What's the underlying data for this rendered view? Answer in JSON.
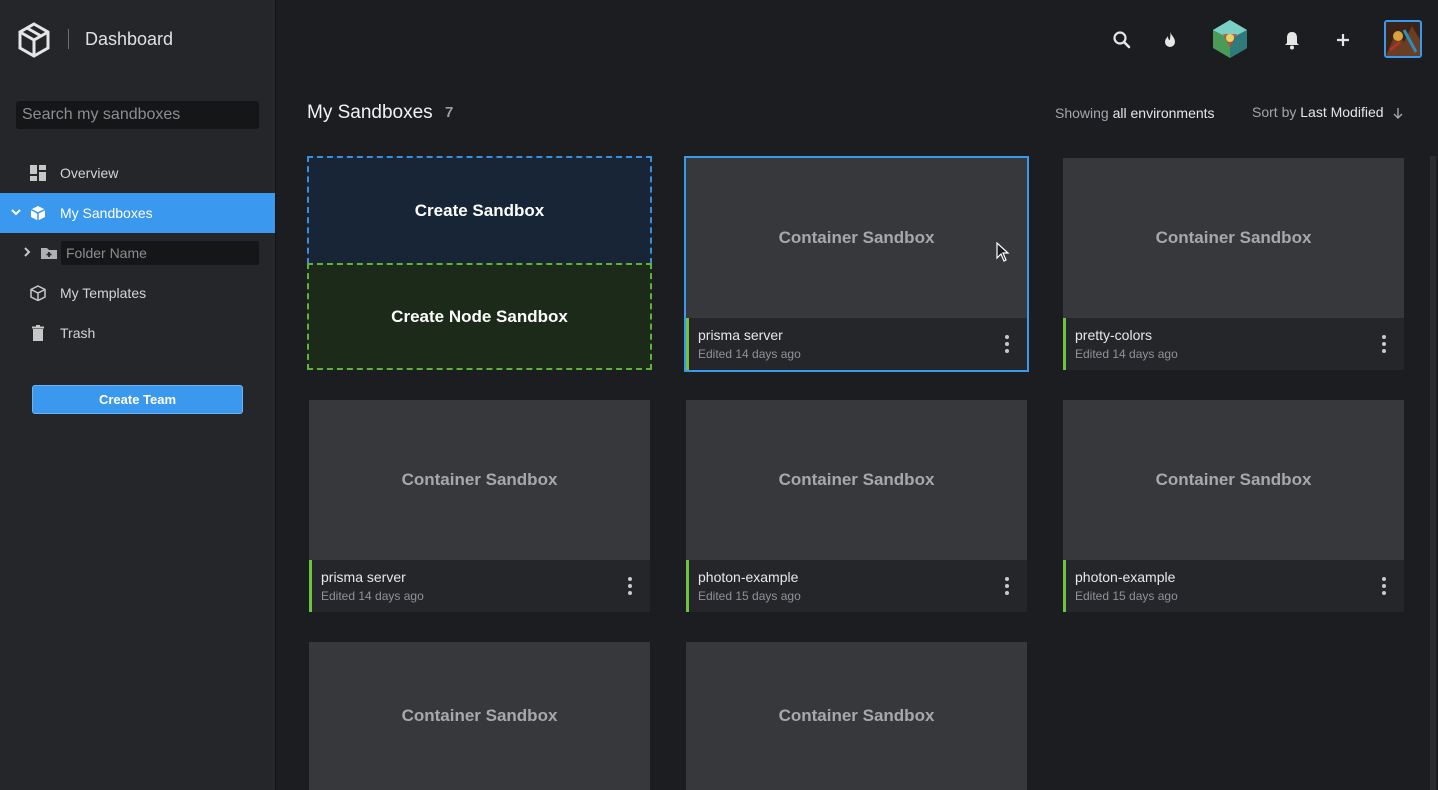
{
  "brand": {
    "title": "Dashboard"
  },
  "sidebar": {
    "search_placeholder": "Search my sandboxes",
    "items": [
      {
        "label": "Overview",
        "icon": "dashboard-icon"
      },
      {
        "label": "My Sandboxes",
        "icon": "box-icon",
        "active": true
      },
      {
        "label": "My Templates",
        "icon": "cube-outline-icon"
      },
      {
        "label": "Trash",
        "icon": "trash-icon"
      }
    ],
    "folder_placeholder": "Folder Name",
    "create_team_label": "Create Team"
  },
  "header": {
    "icons": [
      "search-icon",
      "flame-icon",
      "patron-badge-icon",
      "bell-icon",
      "plus-icon",
      "avatar"
    ]
  },
  "main": {
    "title": "My Sandboxes",
    "count": "7",
    "showing_prefix": "Showing",
    "showing_value": "all environments",
    "sort_prefix": "Sort by",
    "sort_value": "Last Modified",
    "create_sandbox_label": "Create Sandbox",
    "create_node_sandbox_label": "Create Node Sandbox",
    "cards": [
      {
        "thumb": "Container Sandbox",
        "name": "prisma server",
        "edited": "Edited 14 days ago",
        "selected": true
      },
      {
        "thumb": "Container Sandbox",
        "name": "pretty-colors",
        "edited": "Edited 14 days ago"
      },
      {
        "thumb": "Container Sandbox",
        "name": "prisma server",
        "edited": "Edited 14 days ago"
      },
      {
        "thumb": "Container Sandbox",
        "name": "photon-example",
        "edited": "Edited 15 days ago"
      },
      {
        "thumb": "Container Sandbox",
        "name": "photon-example",
        "edited": "Edited 15 days ago"
      },
      {
        "thumb": "Container Sandbox",
        "name": "",
        "edited": ""
      },
      {
        "thumb": "Container Sandbox",
        "name": "",
        "edited": ""
      }
    ]
  },
  "colors": {
    "accent": "#3a98ee",
    "node_green": "#5fb33a",
    "card_stripe": "#6ec43e"
  }
}
